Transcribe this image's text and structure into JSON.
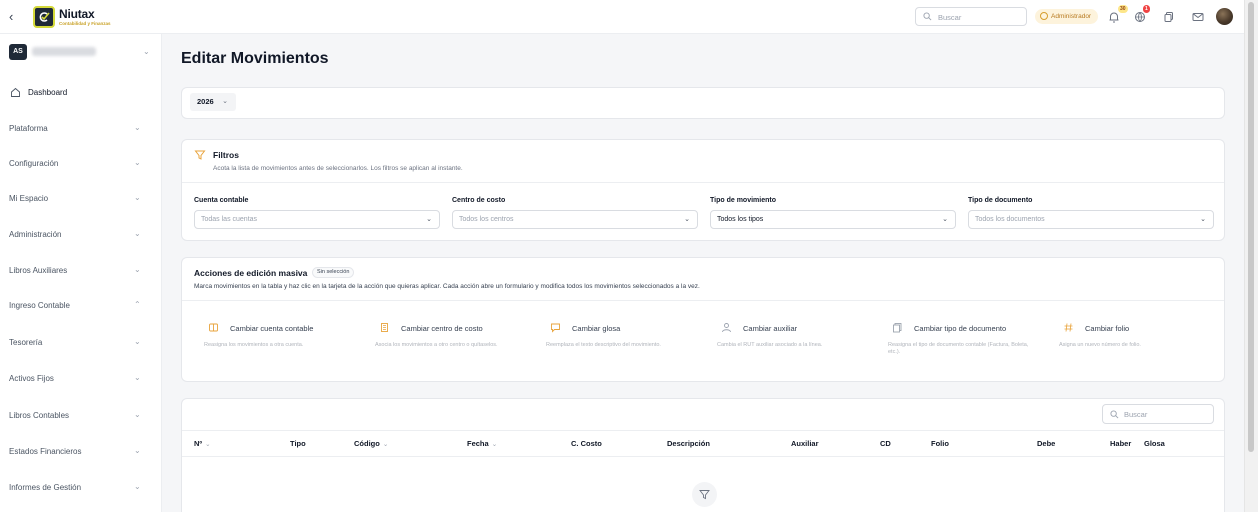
{
  "header": {
    "logo_title": "Niutax",
    "logo_subtitle": "Contabilidad y Finanzas",
    "search_placeholder": "Buscar",
    "role_badge": "Administrador",
    "notifications_count": "30",
    "alerts_count": "1"
  },
  "sidebar": {
    "org_initials": "AS",
    "items": [
      {
        "label": "Dashboard"
      },
      {
        "label": "Plataforma"
      },
      {
        "label": "Configuración"
      },
      {
        "label": "Mi Espacio"
      },
      {
        "label": "Administración"
      },
      {
        "label": "Libros Auxiliares"
      },
      {
        "label": "Ingreso Contable"
      },
      {
        "label": "Tesorería"
      },
      {
        "label": "Activos Fijos"
      },
      {
        "label": "Libros Contables"
      },
      {
        "label": "Estados Financieros"
      },
      {
        "label": "Informes de Gestión"
      }
    ]
  },
  "page": {
    "title": "Editar Movimientos",
    "year": "2026"
  },
  "filters": {
    "title": "Filtros",
    "subtitle": "Acota la lista de movimientos antes de seleccionarlos. Los filtros se aplican al instante.",
    "fields": [
      {
        "label": "Cuenta contable",
        "value": "Todas las cuentas"
      },
      {
        "label": "Centro de costo",
        "value": "Todos los centros"
      },
      {
        "label": "Tipo de movimiento",
        "value": "Todos los tipos"
      },
      {
        "label": "Tipo de documento",
        "value": "Todos los documentos"
      }
    ]
  },
  "bulk": {
    "title": "Acciones de edición masiva",
    "badge": "Sin selección",
    "subtitle": "Marca movimientos en la tabla y haz clic en la tarjeta de la acción que quieras aplicar. Cada acción abre un formulario y modifica todos los movimientos seleccionados a la vez.",
    "actions": [
      {
        "title": "Cambiar cuenta contable",
        "desc": "Reasigna los movimientos a otra cuenta."
      },
      {
        "title": "Cambiar centro de costo",
        "desc": "Asocia los movimientos a otro centro o quítaselos."
      },
      {
        "title": "Cambiar glosa",
        "desc": "Reemplaza el texto descriptivo del movimiento."
      },
      {
        "title": "Cambiar auxiliar",
        "desc": "Cambia el RUT auxiliar asociado a la línea."
      },
      {
        "title": "Cambiar tipo de documento",
        "desc": "Reasigna el tipo de documento contable (Factura, Boleta, etc.)."
      },
      {
        "title": "Cambiar folio",
        "desc": "Asigna un nuevo número de folio."
      }
    ]
  },
  "table": {
    "search_placeholder": "Buscar",
    "columns": [
      "Nº",
      "Tipo",
      "Código",
      "Fecha",
      "C. Costo",
      "Descripción",
      "Auxiliar",
      "CD",
      "Folio",
      "Debe",
      "Haber",
      "Glosa"
    ]
  }
}
